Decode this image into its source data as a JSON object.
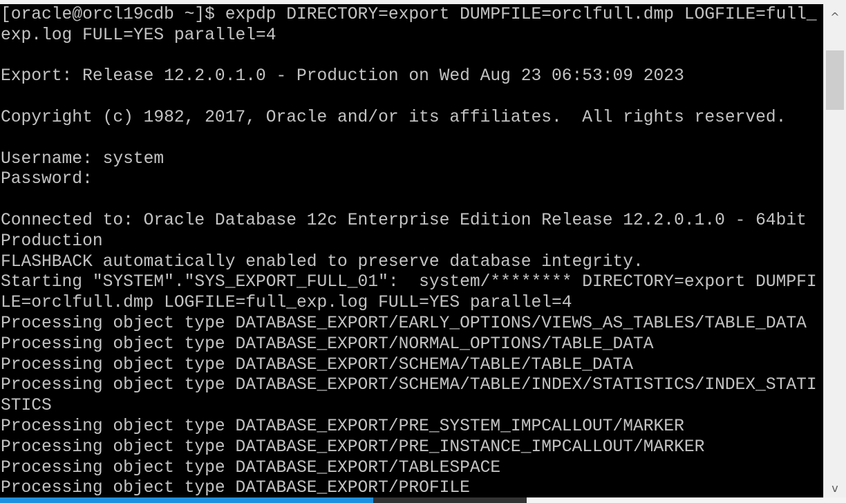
{
  "terminal": {
    "lines": [
      "[oracle@orcl19cdb ~]$ expdp DIRECTORY=export DUMPFILE=orclfull.dmp LOGFILE=full_",
      "exp.log FULL=YES parallel=4",
      "",
      "Export: Release 12.2.0.1.0 - Production on Wed Aug 23 06:53:09 2023",
      "",
      "Copyright (c) 1982, 2017, Oracle and/or its affiliates.  All rights reserved.",
      "",
      "Username: system",
      "Password:",
      "",
      "Connected to: Oracle Database 12c Enterprise Edition Release 12.2.0.1.0 - 64bit",
      "Production",
      "FLASHBACK automatically enabled to preserve database integrity.",
      "Starting \"SYSTEM\".\"SYS_EXPORT_FULL_01\":  system/******** DIRECTORY=export DUMPFI",
      "LE=orclfull.dmp LOGFILE=full_exp.log FULL=YES parallel=4",
      "Processing object type DATABASE_EXPORT/EARLY_OPTIONS/VIEWS_AS_TABLES/TABLE_DATA",
      "Processing object type DATABASE_EXPORT/NORMAL_OPTIONS/TABLE_DATA",
      "Processing object type DATABASE_EXPORT/SCHEMA/TABLE/TABLE_DATA",
      "Processing object type DATABASE_EXPORT/SCHEMA/TABLE/INDEX/STATISTICS/INDEX_STATI",
      "STICS",
      "Processing object type DATABASE_EXPORT/PRE_SYSTEM_IMPCALLOUT/MARKER",
      "Processing object type DATABASE_EXPORT/PRE_INSTANCE_IMPCALLOUT/MARKER",
      "Processing object type DATABASE_EXPORT/TABLESPACE",
      "Processing object type DATABASE_EXPORT/PROFILE"
    ]
  },
  "scrollbar": {
    "up_icon": "chevron-up-icon",
    "down_icon": "chevron-down-icon",
    "up_glyph": "^",
    "down_glyph": "v"
  },
  "colors": {
    "background": "#000000",
    "text": "#c3c3c3",
    "taskbar_accent": "#1e90e0"
  }
}
